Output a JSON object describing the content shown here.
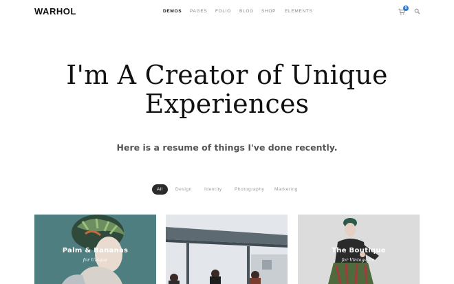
{
  "header": {
    "logo": "WARHOL",
    "nav": [
      {
        "label": "DEMOS",
        "active": true
      },
      {
        "label": "PAGES",
        "active": false
      },
      {
        "label": "FOLIO",
        "active": false
      },
      {
        "label": "BLOG",
        "active": false
      },
      {
        "label": "SHOP",
        "active": false
      },
      {
        "label": "ELEMENTS",
        "active": false
      }
    ],
    "cart_count": "0",
    "icons": {
      "cart": "cart-icon",
      "search": "search-icon"
    }
  },
  "hero": {
    "title_line1": "I'm A Creator of Unique",
    "title_line2": "Experiences",
    "subtitle": "Here is a resume of things I've done recently."
  },
  "filters": [
    {
      "label": "All",
      "active": true
    },
    {
      "label": "Design",
      "active": false
    },
    {
      "label": "Identity",
      "active": false
    },
    {
      "label": "Photography",
      "active": false
    },
    {
      "label": "Marketing",
      "active": false
    }
  ],
  "cards": [
    {
      "title": "Palm & Bananas",
      "subtitle": "for Unique"
    },
    {
      "title": "",
      "subtitle": ""
    },
    {
      "title": "The Boutique",
      "subtitle": "for Vintage Co."
    }
  ],
  "colors": {
    "accent": "#2a7bd1",
    "dark": "#111111",
    "filter_active_bg": "#2b2b2b",
    "card1_bg": "#4f7e81",
    "card3_bg": "#d9d9d9"
  }
}
